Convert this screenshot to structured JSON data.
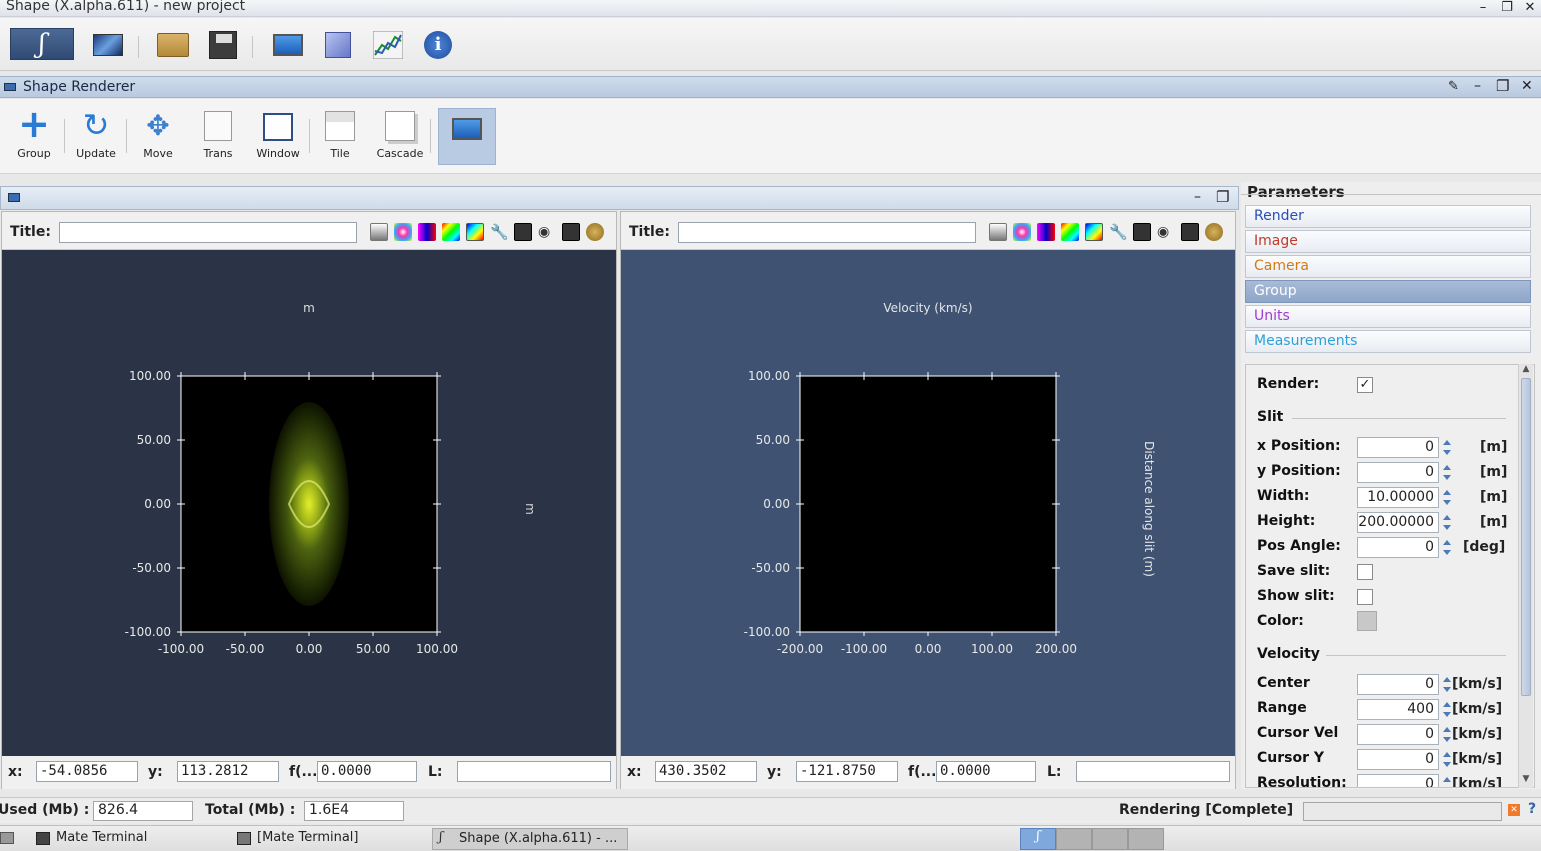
{
  "window": {
    "title": "Shape (X.alpha.611) - new project"
  },
  "toolbar_icons": [
    "shape-logo-icon",
    "render-view-icon",
    "open-folder-icon",
    "save-disk-icon",
    "monitor-icon",
    "cube-icon",
    "graph-icon",
    "info-icon"
  ],
  "renderer_panel": {
    "title": "Shape Renderer"
  },
  "renderer_toolbar": {
    "buttons": [
      {
        "label": "Group",
        "icon": "plus-icon"
      },
      {
        "label": "Update",
        "icon": "refresh-icon"
      },
      {
        "label": "Move",
        "icon": "move-arrows-icon"
      },
      {
        "label": "Trans",
        "icon": "transform-icon"
      },
      {
        "label": "Window",
        "icon": "window-icon"
      },
      {
        "label": "Tile",
        "icon": "tile-icon"
      },
      {
        "label": "Cascade",
        "icon": "cascade-icon"
      },
      {
        "label": "",
        "icon": "monitor-icon"
      }
    ]
  },
  "left_pane": {
    "title_label": "Title:",
    "title_value": "",
    "plot_title": "m",
    "right_axis_label": "m",
    "x_ticks": [
      "-100.00",
      "-50.00",
      "0.00",
      "50.00",
      "100.00"
    ],
    "y_ticks": [
      "100.00",
      "50.00",
      "0.00",
      "-50.00",
      "-100.00"
    ],
    "coords": {
      "x_label": "x:",
      "x": "-54.0856",
      "y_label": "y:",
      "y": "113.2812",
      "f_label": "f(...",
      "f": "0.0000",
      "l_label": "L:",
      "l": ""
    }
  },
  "right_pane": {
    "title_label": "Title:",
    "title_value": "",
    "plot_title": "Velocity (km/s)",
    "right_axis_label": "Distance along slit (m)",
    "x_ticks": [
      "-200.00",
      "-100.00",
      "0.00",
      "100.00",
      "200.00"
    ],
    "y_ticks": [
      "100.00",
      "50.00",
      "0.00",
      "-50.00",
      "-100.00"
    ],
    "coords": {
      "x_label": "x:",
      "x": "430.3502",
      "y_label": "y:",
      "y": "-121.8750",
      "f_label": "f(...",
      "f": "0.0000",
      "l_label": "L:",
      "l": ""
    }
  },
  "parameters": {
    "title": "Parameters",
    "tabs": [
      {
        "label": "Render",
        "color": "#2a4fb4"
      },
      {
        "label": "Image",
        "color": "#c03a2b"
      },
      {
        "label": "Camera",
        "color": "#d07a1a"
      },
      {
        "label": "Group",
        "color": "#ffffff"
      },
      {
        "label": "Units",
        "color": "#a23bd0"
      },
      {
        "label": "Measurements",
        "color": "#2ea0d8"
      }
    ],
    "render_label": "Render:",
    "render_checked": "✓",
    "slit_section": "Slit",
    "slit": [
      {
        "label": "x Position:",
        "value": "0",
        "unit": "[m]"
      },
      {
        "label": "y Position:",
        "value": "0",
        "unit": "[m]"
      },
      {
        "label": "Width:",
        "value": "10.00000",
        "unit": "[m]"
      },
      {
        "label": "Height:",
        "value": "200.00000",
        "unit": "[m]"
      },
      {
        "label": "Pos Angle:",
        "value": "0",
        "unit": "[deg]"
      }
    ],
    "save_slit_label": "Save slit:",
    "show_slit_label": "Show slit:",
    "color_label": "Color:",
    "velocity_section": "Velocity",
    "velocity": [
      {
        "label": "Center",
        "value": "0",
        "unit": "[km/s]"
      },
      {
        "label": "Range",
        "value": "400",
        "unit": "[km/s]"
      },
      {
        "label": "Cursor Vel",
        "value": "0",
        "unit": "[km/s]"
      },
      {
        "label": "Cursor Y",
        "value": "0",
        "unit": "[km/s]"
      },
      {
        "label": "Resolution:",
        "value": "0",
        "unit": "[km/s]"
      }
    ]
  },
  "status": {
    "used_label": "Used (Mb) :",
    "used_value": "826.4",
    "total_label": "Total (Mb) :",
    "total_value": "1.6E4",
    "rendering_text": "Rendering [Complete]"
  },
  "taskbar": {
    "tasks": [
      "Mate Terminal",
      "[Mate Terminal]",
      "Shape (X.alpha.611) - ..."
    ]
  }
}
